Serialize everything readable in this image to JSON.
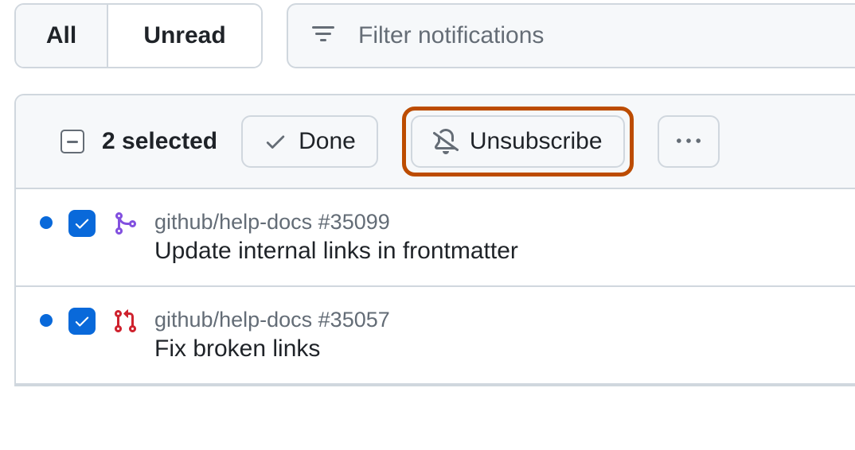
{
  "tabs": {
    "all": "All",
    "unread": "Unread"
  },
  "filter": {
    "placeholder": "Filter notifications"
  },
  "toolbar": {
    "selected_text": "2 selected",
    "done_label": "Done",
    "unsubscribe_label": "Unsubscribe"
  },
  "items": [
    {
      "repo": "github/help-docs",
      "number": "#35099",
      "title": "Update internal links in frontmatter",
      "type": "merged-pr",
      "checked": true,
      "unread": true
    },
    {
      "repo": "github/help-docs",
      "number": "#35057",
      "title": "Fix broken links",
      "type": "open-pr",
      "checked": true,
      "unread": true
    }
  ],
  "colors": {
    "accent_blue": "#0969da",
    "merged_purple": "#8250df",
    "open_red": "#cf222e",
    "highlight_orange": "#bc4c00"
  }
}
